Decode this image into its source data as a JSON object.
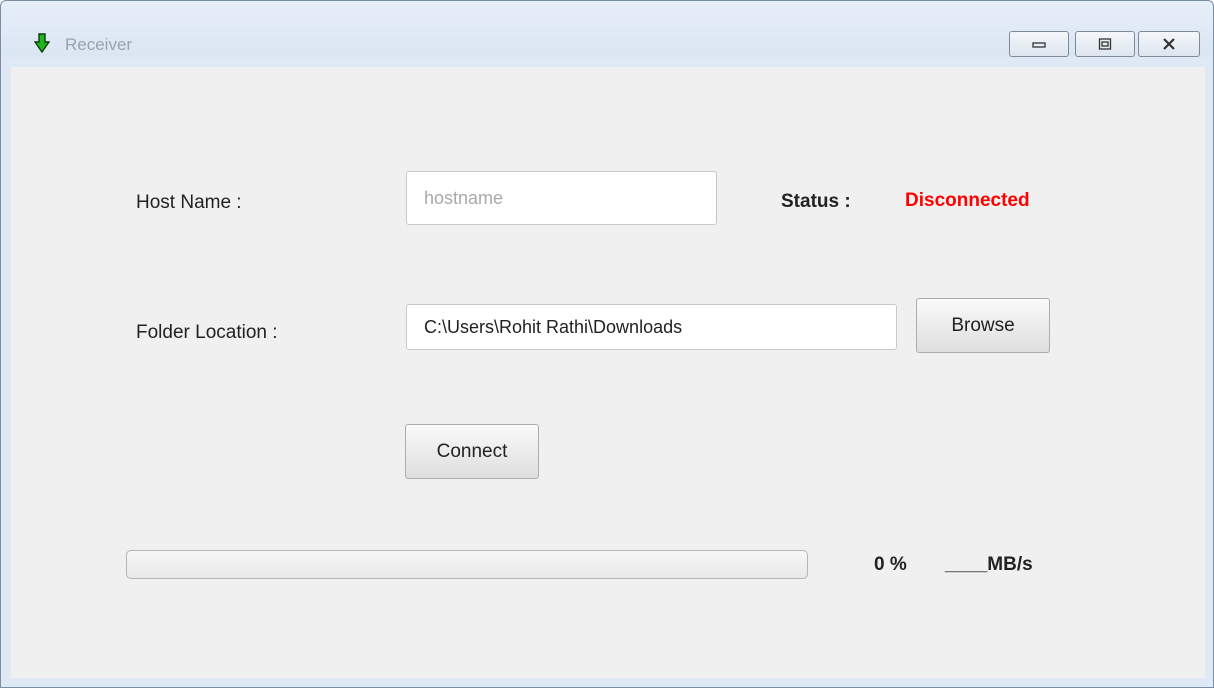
{
  "window": {
    "title": "Receiver"
  },
  "form": {
    "host_label": "Host Name :",
    "host_value": "",
    "host_placeholder": "hostname",
    "status_label": "Status :",
    "status_value": "Disconnected",
    "status_color": "#ff0000",
    "folder_label": "Folder Location :",
    "folder_value": "C:\\Users\\Rohit Rathi\\Downloads",
    "browse_label": "Browse",
    "connect_label": "Connect"
  },
  "transfer": {
    "progress_percent": 0,
    "percent_text": "0 %",
    "speed_text": "____MB/s"
  },
  "icons": {
    "app": "green-down-arrow-icon",
    "minimize": "minimize-icon",
    "maximize": "maximize-icon",
    "close": "close-icon"
  }
}
